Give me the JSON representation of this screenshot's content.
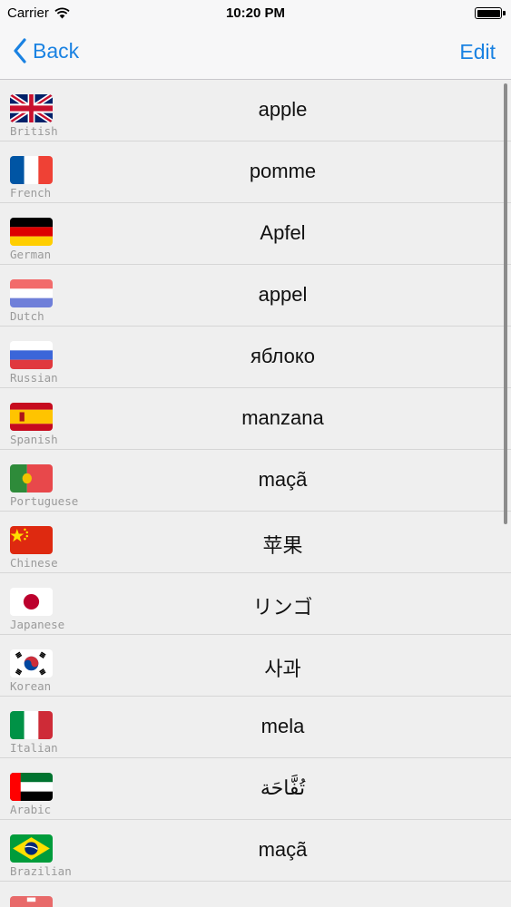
{
  "status": {
    "carrier": "Carrier",
    "time": "10:20 PM"
  },
  "nav": {
    "back_label": "Back",
    "edit_label": "Edit"
  },
  "rows": [
    {
      "language": "British",
      "word": "apple",
      "flag": "uk-flag-icon"
    },
    {
      "language": "French",
      "word": "pomme",
      "flag": "france-flag-icon"
    },
    {
      "language": "German",
      "word": "Apfel",
      "flag": "germany-flag-icon"
    },
    {
      "language": "Dutch",
      "word": "appel",
      "flag": "netherlands-flag-icon"
    },
    {
      "language": "Russian",
      "word": "яблоко",
      "flag": "russia-flag-icon"
    },
    {
      "language": "Spanish",
      "word": "manzana",
      "flag": "spain-flag-icon"
    },
    {
      "language": "Portuguese",
      "word": "maçã",
      "flag": "portugal-flag-icon"
    },
    {
      "language": "Chinese",
      "word": "苹果",
      "flag": "china-flag-icon"
    },
    {
      "language": "Japanese",
      "word": "リンゴ",
      "flag": "japan-flag-icon"
    },
    {
      "language": "Korean",
      "word": "사과",
      "flag": "south-korea-flag-icon"
    },
    {
      "language": "Italian",
      "word": "mela",
      "flag": "italy-flag-icon"
    },
    {
      "language": "Arabic",
      "word": "تُفَّاحَة",
      "flag": "uae-flag-icon"
    },
    {
      "language": "Brazilian",
      "word": "maçã",
      "flag": "brazil-flag-icon"
    }
  ],
  "colors": {
    "accent": "#1a82e2",
    "list_bg": "#efefef",
    "nav_bg": "#f7f7f8"
  }
}
